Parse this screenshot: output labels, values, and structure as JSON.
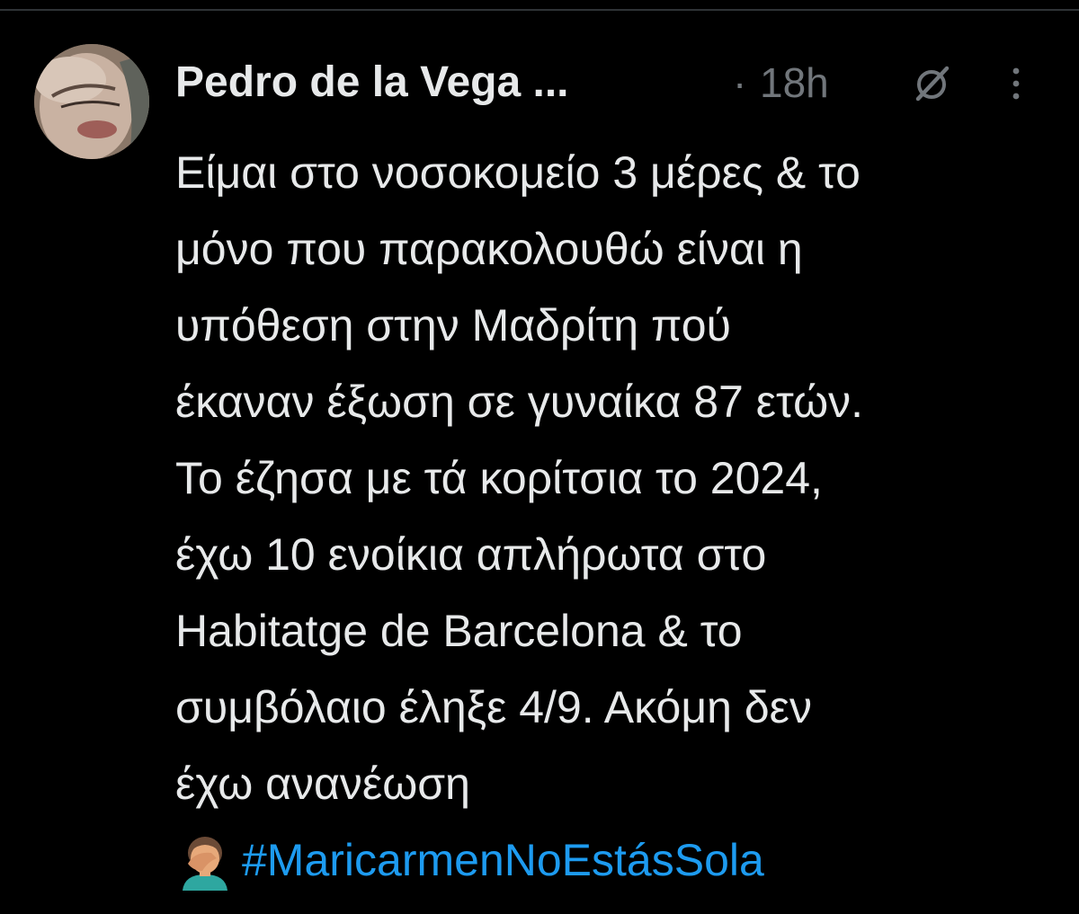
{
  "colors": {
    "background": "#000000",
    "text_primary": "#e7e9ea",
    "text_secondary": "#71767b",
    "link": "#1d9bf0",
    "divider": "#2f3336"
  },
  "tweet": {
    "author": {
      "name": "Pedro de la Vega ...",
      "avatar_icon": "avatar"
    },
    "separator": "·",
    "timestamp": "18h",
    "grok_icon": "grok-icon",
    "more_icon": "more-vertical-icon",
    "body_lines": [
      "Είμαι στο νοσοκομείο 3 μέρες & το",
      "μόνο που παρακολουθώ είναι η",
      "υπόθεση στην Μαδρίτη πού",
      "έκαναν έξωση σε γυναίκα 87 ετών.",
      "Το έζησα με τά κορίτσια το 2024,",
      "έχω 10 ενοίκια απλήρωτα στο",
      "Habitatge de Barcelona & το",
      "συμβόλαιο έληξε 4/9. Ακόμη δεν",
      "έχω ανανέωση"
    ],
    "emoji": "facepalm-emoji",
    "hashtag": "#MaricarmenNoEstásSola"
  }
}
